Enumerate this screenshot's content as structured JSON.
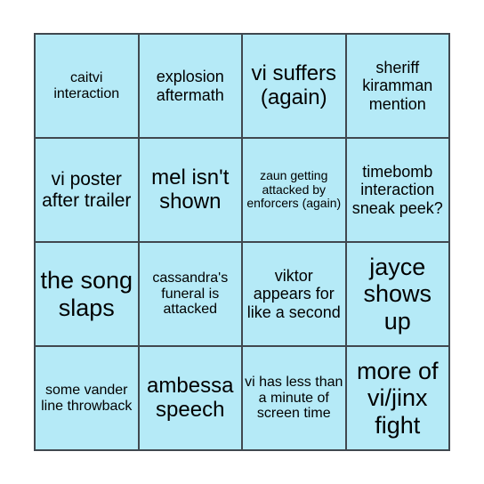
{
  "card": {
    "type": "bingo-card",
    "grid": {
      "rows": 4,
      "columns": 4
    },
    "colors": {
      "cell_background": "#b5eaf7",
      "border": "#40484f",
      "text": "#000000",
      "page_background": "#ffffff"
    },
    "cells": [
      {
        "id": "r1c1",
        "text": "caitvi interaction",
        "size": "s"
      },
      {
        "id": "r1c2",
        "text": "explosion aftermath",
        "size": "m"
      },
      {
        "id": "r1c3",
        "text": "vi suffers (again)",
        "size": "xl"
      },
      {
        "id": "r1c4",
        "text": "sheriff kiramman mention",
        "size": "m"
      },
      {
        "id": "r2c1",
        "text": "vi poster after trailer",
        "size": "l"
      },
      {
        "id": "r2c2",
        "text": "mel isn't shown",
        "size": "xl"
      },
      {
        "id": "r2c3",
        "text": "zaun getting attacked by enforcers (again)",
        "size": "xs"
      },
      {
        "id": "r2c4",
        "text": "timebomb interaction sneak peek?",
        "size": "m"
      },
      {
        "id": "r3c1",
        "text": "the song slaps",
        "size": "xxl"
      },
      {
        "id": "r3c2",
        "text": "cassandra's funeral is attacked",
        "size": "s"
      },
      {
        "id": "r3c3",
        "text": "viktor appears for like a second",
        "size": "m"
      },
      {
        "id": "r3c4",
        "text": "jayce shows up",
        "size": "xxl"
      },
      {
        "id": "r4c1",
        "text": "some vander line throwback",
        "size": "s"
      },
      {
        "id": "r4c2",
        "text": "ambessa speech",
        "size": "xl"
      },
      {
        "id": "r4c3",
        "text": "vi has less than a minute of screen time",
        "size": "s"
      },
      {
        "id": "r4c4",
        "text": "more of vi/jinx fight",
        "size": "xxl"
      }
    ]
  }
}
